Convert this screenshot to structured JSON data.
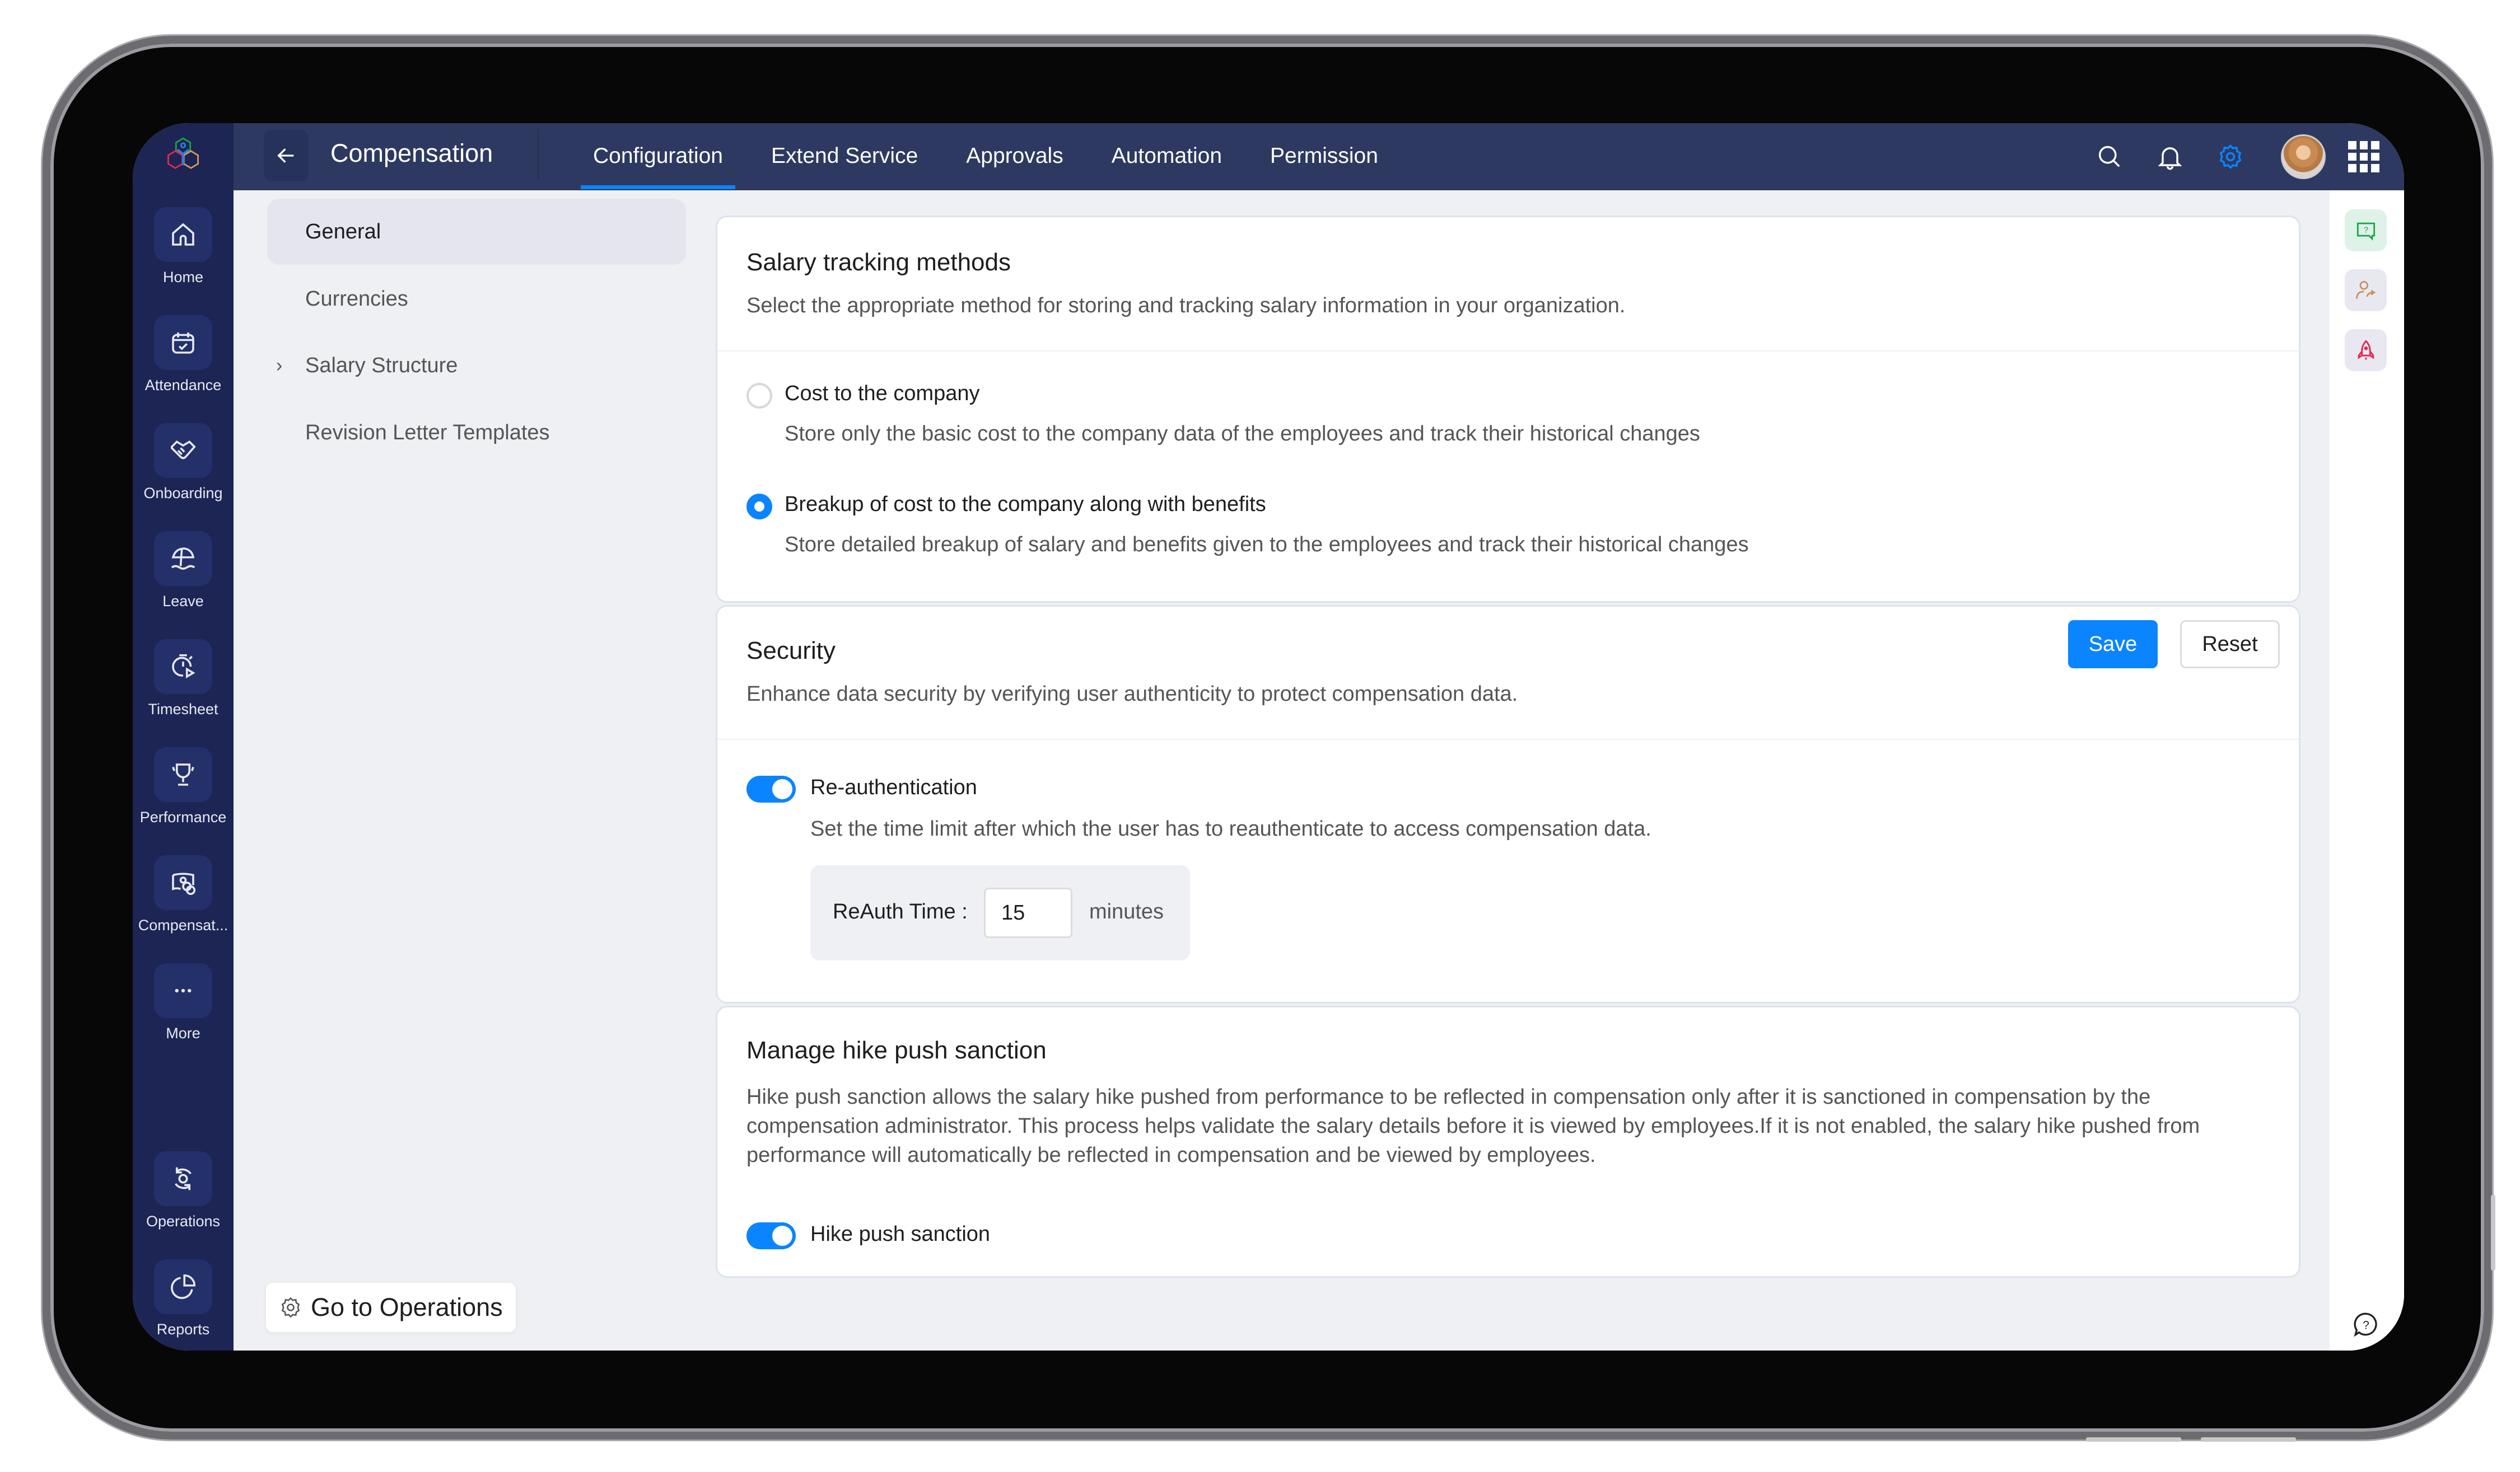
{
  "app": {
    "title": "Compensation",
    "logo_icon": "hexagon-cluster-logo"
  },
  "header": {
    "tabs": [
      {
        "label": "Configuration",
        "active": true
      },
      {
        "label": "Extend Service",
        "active": false
      },
      {
        "label": "Approvals",
        "active": false
      },
      {
        "label": "Automation",
        "active": false
      },
      {
        "label": "Permission",
        "active": false
      }
    ],
    "icons": [
      "search-icon",
      "bell-icon",
      "gear-icon",
      "avatar",
      "apps-grid-icon"
    ],
    "active_icon_color": "#0a84ff"
  },
  "sidebar": {
    "items": [
      {
        "label": "Home",
        "icon": "home-icon"
      },
      {
        "label": "Attendance",
        "icon": "calendar-check-icon"
      },
      {
        "label": "Onboarding",
        "icon": "handshake-icon"
      },
      {
        "label": "Leave",
        "icon": "beach-umbrella-icon"
      },
      {
        "label": "Timesheet",
        "icon": "stopwatch-icon"
      },
      {
        "label": "Performance",
        "icon": "trophy-icon"
      },
      {
        "label": "Compensat...",
        "icon": "money-coins-icon"
      },
      {
        "label": "More",
        "icon": "more-dots-icon"
      }
    ],
    "bottom_items": [
      {
        "label": "Operations",
        "icon": "operations-icon"
      },
      {
        "label": "Reports",
        "icon": "pie-chart-icon"
      }
    ]
  },
  "subnav": {
    "items": [
      {
        "label": "General",
        "active": true
      },
      {
        "label": "Currencies",
        "active": false
      },
      {
        "label": "Salary Structure",
        "active": false,
        "expandable": true
      },
      {
        "label": "Revision Letter Templates",
        "active": false
      }
    ],
    "go_to_operations": "Go to Operations"
  },
  "salary_tracking": {
    "title": "Salary tracking methods",
    "description": "Select the appropriate method for storing and tracking salary information in your organization.",
    "options": [
      {
        "label": "Cost to the company",
        "description": "Store only the basic cost to the company data of the employees and track their historical changes",
        "selected": false
      },
      {
        "label": "Breakup of cost to the company along with benefits",
        "description": "Store detailed breakup of salary and benefits given to the employees and track their historical changes",
        "selected": true
      }
    ]
  },
  "security": {
    "title": "Security",
    "description": "Enhance data security by verifying user authenticity to protect compensation data.",
    "save_label": "Save",
    "reset_label": "Reset",
    "reauth": {
      "label": "Re-authentication",
      "enabled": true,
      "description": "Set the time limit after which the user has to reauthenticate to access compensation data.",
      "time_label": "ReAuth Time :",
      "time_value": "15",
      "time_unit": "minutes"
    }
  },
  "hike_sanction": {
    "title": "Manage hike push sanction",
    "description": "Hike push sanction allows the salary hike pushed from performance to be reflected in compensation only after it is sanctioned in compensation by the compensation administrator. This process helps validate the salary details before it is viewed by employees.If it is not enabled, the salary hike pushed from performance will automatically be reflected in compensation and be viewed by employees.",
    "toggle_label": "Hike push sanction",
    "enabled": true
  },
  "right_rail": {
    "icons": [
      "help-chat-icon",
      "user-share-icon",
      "rocket-icon",
      "help-bubble-icon"
    ]
  },
  "colors": {
    "sidebar_bg": "#1c2553",
    "header_bg": "#2d3960",
    "accent": "#0a84ff",
    "page_bg": "#eff0f4"
  }
}
